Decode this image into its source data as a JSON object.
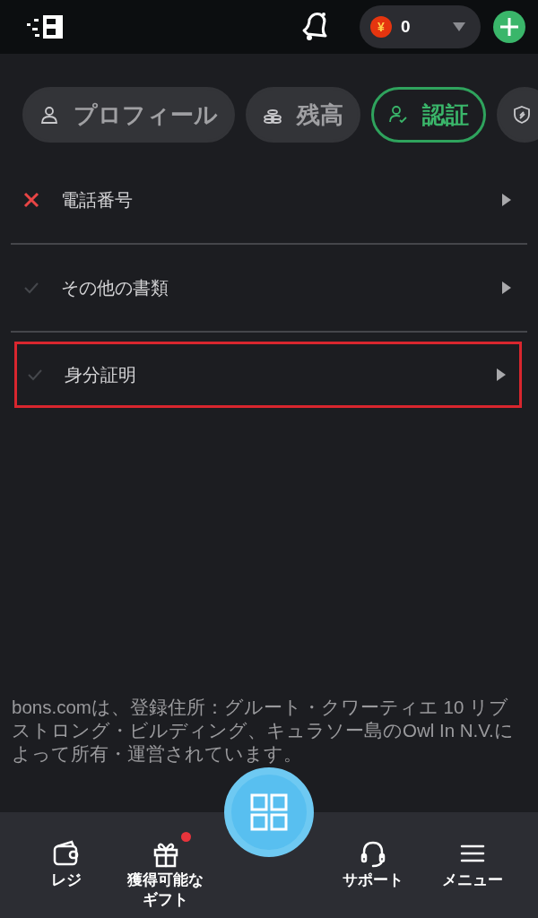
{
  "header": {
    "balance": "0",
    "currency_symbol": "¥"
  },
  "tabs": [
    {
      "kind": "profile",
      "label": "プロフィール",
      "selected": false
    },
    {
      "kind": "balance",
      "label": "残高",
      "selected": false
    },
    {
      "kind": "verification",
      "label": "認証",
      "selected": true
    },
    {
      "kind": "security",
      "selected": false
    }
  ],
  "verification_items": [
    {
      "label": "電話番号",
      "kind": "failed",
      "highlighted": false
    },
    {
      "label": "その他の書類",
      "kind": "pending",
      "highlighted": false
    },
    {
      "label": "身分証明",
      "kind": "pending",
      "highlighted": true
    }
  ],
  "footer_text": "bons.comは、登録住所：グルート・クワーティエ 10 リブストロング・ビルディング、キュラソー島のOwl In N.V.によって所有・運営されています。",
  "bottom_nav": [
    {
      "kind": "wallet",
      "label": "レジ",
      "badge": false
    },
    {
      "kind": "gift",
      "label": "獲得可能なギフト",
      "badge": true
    },
    {
      "kind": "grid"
    },
    {
      "kind": "support",
      "label": "サポート",
      "badge": false
    },
    {
      "kind": "menu",
      "label": "メニュー",
      "badge": false
    }
  ]
}
